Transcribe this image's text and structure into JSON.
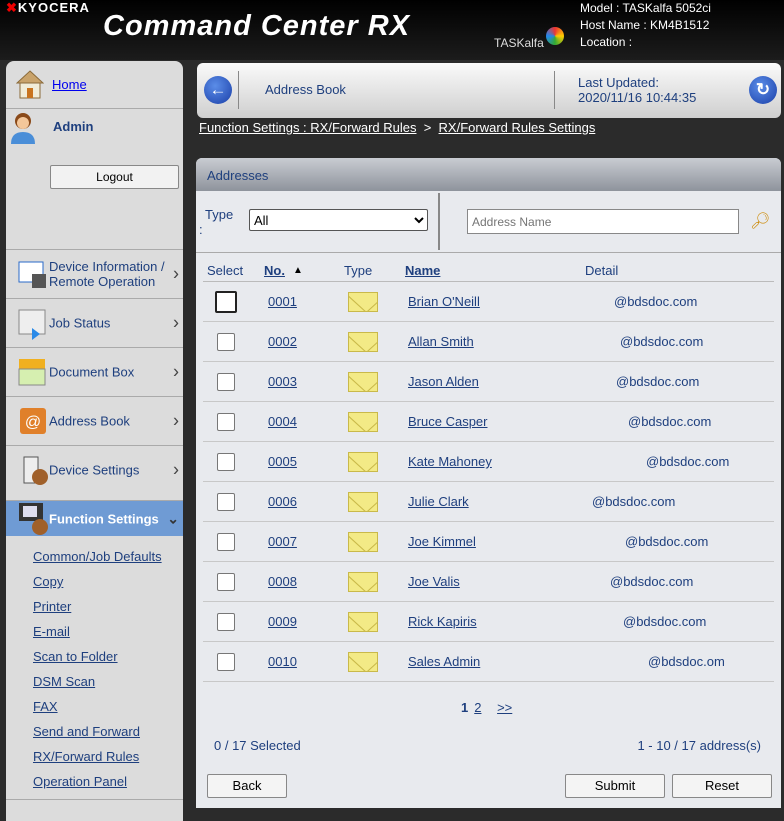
{
  "header": {
    "brand": "KYOCERA",
    "product": "Command Center RX",
    "series": "TASKalfa",
    "model": "Model : TASKalfa 5052ci",
    "host": "Host Name : KM4B1512",
    "location": "Location :"
  },
  "sidebar": {
    "home": "Home",
    "user": "Admin",
    "logout": "Logout",
    "items": [
      {
        "label": "Device Information / Remote Operation",
        "icon": "device-info-icon"
      },
      {
        "label": "Job Status",
        "icon": "job-status-icon"
      },
      {
        "label": "Document Box",
        "icon": "document-box-icon"
      },
      {
        "label": "Address Book",
        "icon": "address-book-icon"
      },
      {
        "label": "Device Settings",
        "icon": "device-settings-icon"
      },
      {
        "label": "Function Settings",
        "icon": "function-settings-icon"
      }
    ],
    "sub_items": [
      "Common/Job Defaults",
      "Copy",
      "Printer",
      "E-mail",
      "Scan to Folder",
      "DSM Scan",
      "FAX",
      "Send and Forward",
      "RX/Forward Rules",
      "Operation Panel"
    ]
  },
  "topbar": {
    "title": "Address Book",
    "updated_label": "Last Updated:",
    "updated_value": "2020/11/16 10:44:35"
  },
  "breadcrumb": {
    "first": "Function Settings : RX/Forward Rules",
    "sep": ">",
    "second": "RX/Forward Rules Settings"
  },
  "panel": {
    "title": "Addresses",
    "type_label": "Type",
    "type_colon": ":",
    "type_value": "All",
    "search_placeholder": "Address Name",
    "columns": {
      "select": "Select",
      "no": "No.",
      "type": "Type",
      "name": "Name",
      "detail": "Detail"
    },
    "rows": [
      {
        "no": "0001",
        "name": "Brian O'Neill",
        "detail": "@bdsdoc.com"
      },
      {
        "no": "0002",
        "name": "Allan Smith",
        "detail": "@bdsdoc.com"
      },
      {
        "no": "0003",
        "name": "Jason Alden",
        "detail": "@bdsdoc.com"
      },
      {
        "no": "0004",
        "name": "Bruce Casper",
        "detail": "@bdsdoc.com"
      },
      {
        "no": "0005",
        "name": "Kate Mahoney",
        "detail": "@bdsdoc.com"
      },
      {
        "no": "0006",
        "name": "Julie Clark",
        "detail": "@bdsdoc.com"
      },
      {
        "no": "0007",
        "name": "Joe Kimmel",
        "detail": "@bdsdoc.com"
      },
      {
        "no": "0008",
        "name": "Joe Valis",
        "detail": "@bdsdoc.com"
      },
      {
        "no": "0009",
        "name": "Rick Kapiris",
        "detail": "@bdsdoc.com"
      },
      {
        "no": "0010",
        "name": "Sales Admin",
        "detail": "@bdsdoc.om"
      }
    ],
    "pages": [
      "1",
      "2",
      ">>"
    ],
    "selected": "0 / 17 Selected",
    "range": "1 - 10 / 17 address(s)",
    "back": "Back",
    "submit": "Submit",
    "reset": "Reset"
  }
}
